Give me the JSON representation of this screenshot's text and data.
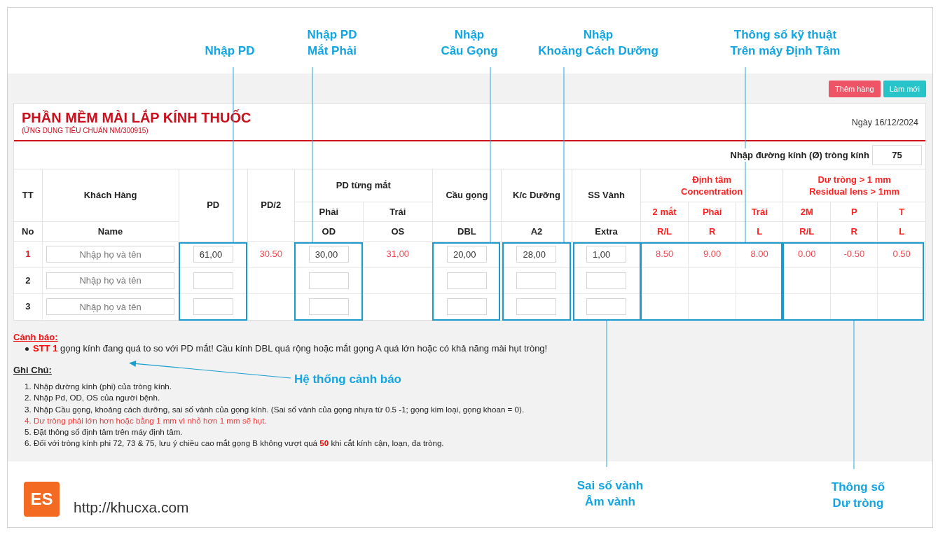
{
  "top_callouts": [
    {
      "text": "Nhập PD"
    },
    {
      "text": "Nhập PD\nMắt Phải"
    },
    {
      "text": "Nhập\nCầu Gọng"
    },
    {
      "text": "Nhập\nKhoảng Cách Dưỡng"
    },
    {
      "text": "Thông số kỹ thuật\nTrên máy Định Tâm"
    }
  ],
  "toolbar": {
    "buttons": [
      {
        "label": "Thêm hàng",
        "kind": "add"
      },
      {
        "label": "Làm mới",
        "kind": "reset"
      }
    ]
  },
  "header": {
    "title": "PHẦN MỀM MÀI LẮP KÍNH THUỐC",
    "subtitle": "(ỨNG DỤNG TIÊU CHUẨN NM/300915)",
    "date": "Ngày 16/12/2024"
  },
  "lens_diameter": {
    "label": "Nhập đường kính (Ø) tròng kính",
    "value": "75"
  },
  "table": {
    "header_rows": [
      [
        {
          "text": "TT",
          "emphasized": false
        },
        {
          "text": "Khách Hàng",
          "emphasized": false
        },
        {
          "text": "PD",
          "emphasized": false
        },
        {
          "text": "PD/2",
          "emphasized": false
        },
        {
          "text": "PD từng mắt",
          "emphasized": false
        },
        {
          "text": "Cầu gọng",
          "emphasized": false
        },
        {
          "text": "K/c Dưỡng",
          "emphasized": false
        },
        {
          "text": "SS Vành",
          "emphasized": false
        },
        {
          "text": "Định tâm\nConcentration",
          "emphasized": true
        },
        {
          "text": "Dư tròng > 1 mm\nResidual lens > 1mm",
          "emphasized": true
        }
      ],
      [
        {
          "text": "Phải",
          "emphasized": false
        },
        {
          "text": "Trái",
          "emphasized": false
        },
        {
          "text": "2 mắt",
          "emphasized": true
        },
        {
          "text": "Phải",
          "emphasized": true
        },
        {
          "text": "Trái",
          "emphasized": true
        },
        {
          "text": "2M",
          "emphasized": true
        },
        {
          "text": "P",
          "emphasized": true
        },
        {
          "text": "T",
          "emphasized": true
        }
      ],
      [
        {
          "text": "No",
          "emphasized": false
        },
        {
          "text": "Name",
          "emphasized": false
        },
        {
          "text": "OD",
          "emphasized": false
        },
        {
          "text": "OS",
          "emphasized": false
        },
        {
          "text": "DBL",
          "emphasized": false
        },
        {
          "text": "A2",
          "emphasized": false
        },
        {
          "text": "Extra",
          "emphasized": false
        },
        {
          "text": "R/L",
          "emphasized": true
        },
        {
          "text": "R",
          "emphasized": true
        },
        {
          "text": "L",
          "emphasized": true
        },
        {
          "text": "R/L",
          "emphasized": true
        },
        {
          "text": "R",
          "emphasized": true
        },
        {
          "text": "L",
          "emphasized": true
        }
      ]
    ],
    "rows": [
      {
        "no": "1",
        "flagged": true,
        "name": {
          "placeholder": "Nhập họ và tên"
        },
        "pd": "61,00",
        "pd_half": "30.50",
        "od": "30,00",
        "os": "31,00",
        "dbl": "20,00",
        "a2": "28,00",
        "extra": "1,00",
        "centering": [
          "8.50",
          "9.00",
          "8.00"
        ],
        "residual": [
          "0.00",
          "-0.50",
          "0.50"
        ]
      },
      {
        "no": "2",
        "flagged": false,
        "name": {
          "placeholder": "Nhập họ và tên"
        }
      },
      {
        "no": "3",
        "flagged": false,
        "name": {
          "placeholder": "Nhập họ và tên"
        }
      }
    ]
  },
  "warnings": {
    "title": "Cảnh báo:",
    "items": [
      "**STT 1** gọng kính đang quá to so với PD mắt! Cầu kính DBL quá rộng hoặc mắt gọng A quá lớn hoặc có khả năng mài hụt tròng!"
    ]
  },
  "warning_callout": {
    "text": "Hệ thống cảnh báo"
  },
  "notes": {
    "title": "Ghi Chú:",
    "items": [
      {
        "text": "1. Nhập đường kính (phi) của tròng kính.",
        "highlighted": false
      },
      {
        "text": "2. Nhập Pd, OD, OS của người bệnh.",
        "highlighted": false
      },
      {
        "text": "3. Nhập Cầu gọng, khoảng cách dưỡng, sai số vành của gọng kính. (Sai số vành của gọng nhựa từ 0.5 -1; gọng kim loại, gọng khoan = 0).",
        "highlighted": false
      },
      {
        "text": "4. Dư tròng phải lớn hơn hoặc bằng 1 mm vì nhỏ hơn 1 mm sẽ hụt.",
        "highlighted": true
      },
      {
        "text": "5. Đặt thông số định tâm trên máy định tâm.",
        "highlighted": false
      },
      {
        "text": "6. Đối với tròng kính phi 72, 73 & 75, lưu ý chiều cao mắt gọng B không vượt quá **50** khi cắt kính cận, loạn, đa tròng.",
        "highlighted": false
      }
    ]
  },
  "footer": {
    "logo": "ES",
    "url": "http://khucxa.com"
  },
  "bottom_callouts": [
    {
      "text": "Sai số vành\nÂm vành"
    },
    {
      "text": "Thông số\nDư tròng"
    }
  ]
}
